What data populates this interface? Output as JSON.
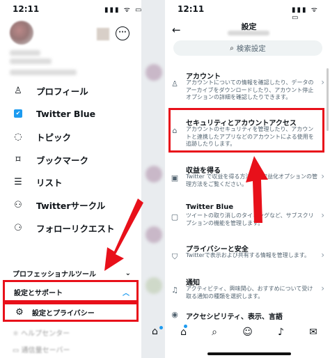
{
  "left": {
    "status_time": "12:11",
    "status_icons": "▮▮▮ ᯤ ▭",
    "more_label": "···",
    "menu": [
      {
        "icon": "person-icon",
        "glyph": "♙",
        "label": "プロフィール"
      },
      {
        "icon": "twitter-blue-icon",
        "glyph": "🐦",
        "label": "Twitter Blue"
      },
      {
        "icon": "topic-icon",
        "glyph": "◌",
        "label": "トピック"
      },
      {
        "icon": "bookmark-icon",
        "glyph": "⌑",
        "label": "ブックマーク"
      },
      {
        "icon": "list-icon",
        "glyph": "☰",
        "label": "リスト"
      },
      {
        "icon": "circle-icon",
        "glyph": "⚇",
        "label": "Twitterサークル"
      },
      {
        "icon": "follow-request-icon",
        "glyph": "⚆",
        "label": "フォローリクエスト"
      }
    ],
    "professional_tools": "プロフェッショナルツール",
    "settings_support": "設定とサポート",
    "settings_privacy": "設定とプライバシー",
    "chevron_down": "⌄",
    "chevron_up": "︿"
  },
  "right": {
    "status_time": "12:11",
    "status_icons": "▮▮▮ ᯤ ▭",
    "back": "←",
    "title": "設定",
    "search_placeholder": "検索設定",
    "items": [
      {
        "icon": "person-icon",
        "glyph": "♙",
        "title": "アカウント",
        "desc": "アカウントについての情報を確認したり、データのアーカイブをダウンロードしたり、アカウント停止オプションの詳細を確認したりできます。"
      },
      {
        "icon": "lock-icon",
        "glyph": "🔒",
        "title": "セキュリティとアカウントアクセス",
        "desc": "アカウントのセキュリティを管理したり、アカウントと連携したアプリなどのアカウントによる使用を追跡したりします。"
      },
      {
        "icon": "money-icon",
        "glyph": "▣",
        "title": "収益を得る",
        "desc": "Twitter で収益を得る方法と、収益化オプションの管理方法をご覧ください。"
      },
      {
        "icon": "twitter-blue-icon",
        "glyph": "▢",
        "title": "Twitter Blue",
        "desc": "ツイートの取り消しのタイミングなど、サブスクリプションの機能を管理します。"
      },
      {
        "icon": "shield-icon",
        "glyph": "⛉",
        "title": "プライバシーと安全",
        "desc": "Twitterで表示および共有する情報を管理します。"
      },
      {
        "icon": "bell-icon",
        "glyph": "♫",
        "title": "通知",
        "desc": "アクティビティ、興味関心、おすすめについて受け取る通知の種類を選択します。"
      },
      {
        "icon": "accessibility-icon",
        "glyph": "◉",
        "title": "アクセシビリティ、表示、言語",
        "desc": ""
      }
    ],
    "chevron": "›",
    "tabs": [
      "⌂",
      "⌕",
      "☺",
      "♪",
      "✉"
    ]
  },
  "colors": {
    "accent": "#1d9bf0",
    "highlight": "#e8101a"
  }
}
